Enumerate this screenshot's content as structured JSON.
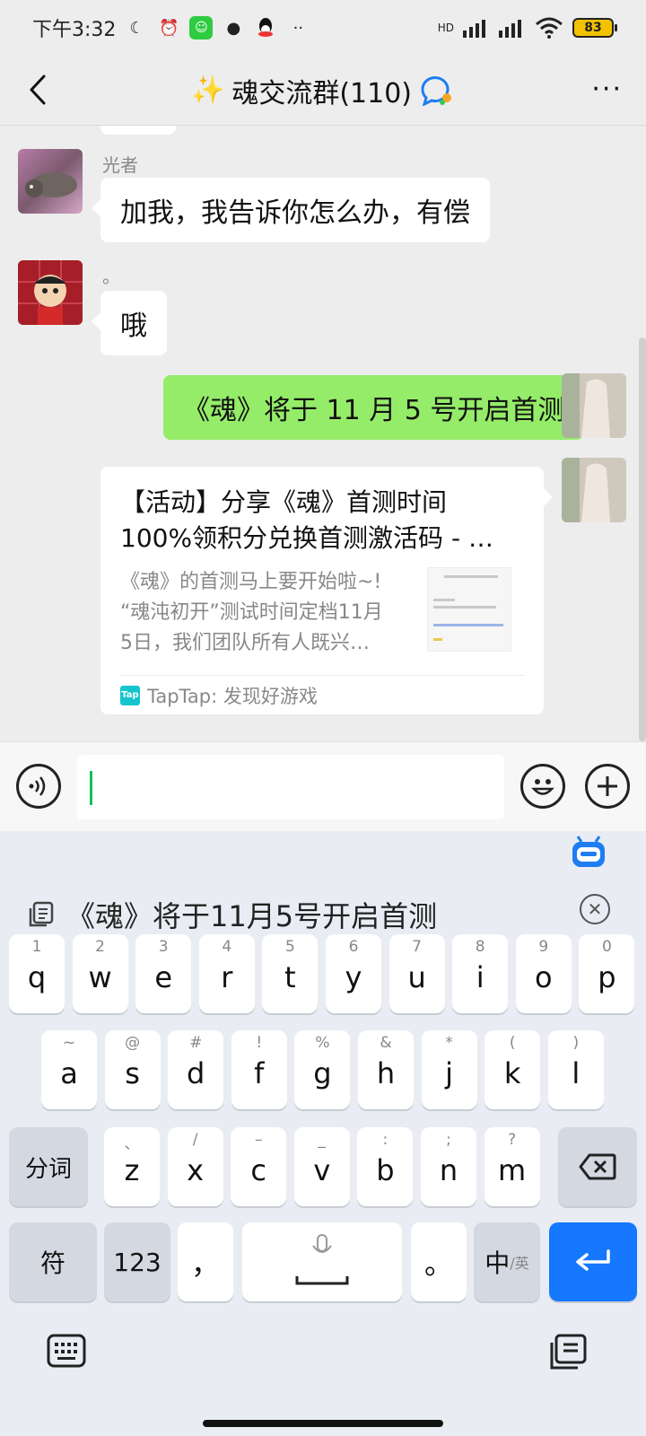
{
  "status_bar": {
    "time": "下午3:32",
    "network": "HD",
    "battery": "83"
  },
  "header": {
    "title_emoji": "✨",
    "title": "魂交流群(110)",
    "back_icon": "chevron-left-icon",
    "more_label": "···"
  },
  "messages": [
    {
      "sender": "光者",
      "text": "加我，我告诉你怎么办，有偿",
      "side": "left"
    },
    {
      "sender": "。",
      "text": "哦",
      "side": "left"
    },
    {
      "sender": "",
      "text": "《魂》将于 11 月 5 号开启首测",
      "side": "right"
    }
  ],
  "link_card": {
    "title": "【活动】分享《魂》首测时间\n100%领积分兑换首测激活码 - …",
    "description": "《魂》的首测马上要开始啦~!\n“魂沌初开”测试时间定档11月\n5日，我们团队所有人既兴…",
    "source_logo": "Tap",
    "source": "TapTap: 发现好游戏"
  },
  "input": {
    "value": ""
  },
  "keyboard": {
    "clipboard_text": "《魂》将于11月5号开启首测",
    "row1": [
      {
        "hint": "1",
        "key": "q"
      },
      {
        "hint": "2",
        "key": "w"
      },
      {
        "hint": "3",
        "key": "e"
      },
      {
        "hint": "4",
        "key": "r"
      },
      {
        "hint": "5",
        "key": "t"
      },
      {
        "hint": "6",
        "key": "y"
      },
      {
        "hint": "7",
        "key": "u"
      },
      {
        "hint": "8",
        "key": "i"
      },
      {
        "hint": "9",
        "key": "o"
      },
      {
        "hint": "0",
        "key": "p"
      }
    ],
    "row2": [
      {
        "hint": "~",
        "key": "a"
      },
      {
        "hint": "@",
        "key": "s"
      },
      {
        "hint": "#",
        "key": "d"
      },
      {
        "hint": "!",
        "key": "f"
      },
      {
        "hint": "%",
        "key": "g"
      },
      {
        "hint": "&",
        "key": "h"
      },
      {
        "hint": "*",
        "key": "j"
      },
      {
        "hint": "(",
        "key": "k"
      },
      {
        "hint": ")",
        "key": "l"
      }
    ],
    "row3": [
      {
        "hint": "、",
        "key": "z"
      },
      {
        "hint": "/",
        "key": "x"
      },
      {
        "hint": "–",
        "key": "c"
      },
      {
        "hint": "_",
        "key": "v"
      },
      {
        "hint": ":",
        "key": "b"
      },
      {
        "hint": ";",
        "key": "n"
      },
      {
        "hint": "?",
        "key": "m"
      }
    ],
    "fenci_label": "分词",
    "symbol_label": "符",
    "num_label": "123",
    "comma_label": "，",
    "period_label": "。",
    "lang_main": "中",
    "lang_sub": "/英"
  }
}
